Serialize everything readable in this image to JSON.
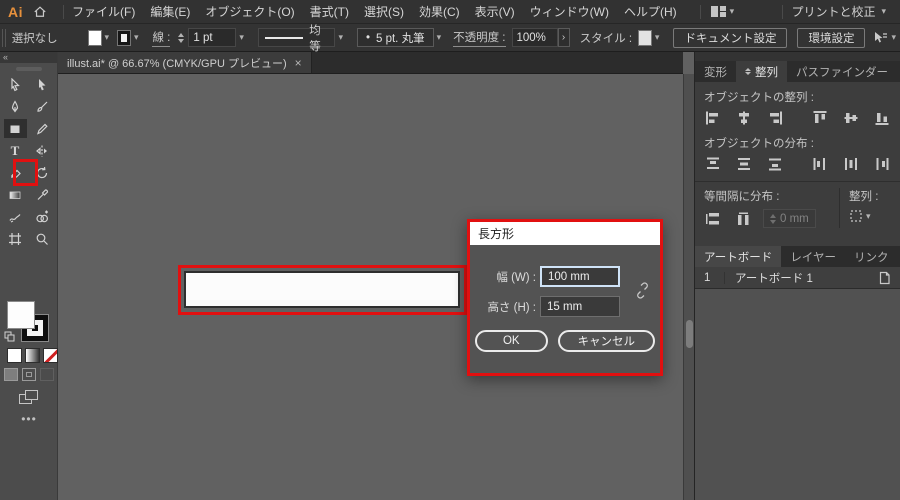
{
  "menu": {
    "logo": "Ai",
    "items": [
      "ファイル(F)",
      "編集(E)",
      "オブジェクト(O)",
      "書式(T)",
      "選択(S)",
      "効果(C)",
      "表示(V)",
      "ウィンドウ(W)",
      "ヘルプ(H)"
    ],
    "workspace": "プリントと校正"
  },
  "options": {
    "selection_status": "選択なし",
    "stroke_label": "線 :",
    "stroke_weight": "1 pt",
    "stroke_profile": "均等",
    "brush_bullet": "•",
    "brush_name": "5 pt. 丸筆",
    "opacity_label": "不透明度 :",
    "opacity_value": "100%",
    "opacity_more": "›",
    "style_label": "スタイル :",
    "document_setup": "ドキュメント設定",
    "preferences": "環境設定"
  },
  "doc_tab": {
    "title": "illust.ai* @ 66.67% (CMYK/GPU プレビュー)",
    "close": "×"
  },
  "dialog": {
    "title": "長方形",
    "width_label": "幅 (W) :",
    "width_value": "100 mm",
    "height_label": "高さ (H) :",
    "height_value": "15 mm",
    "ok": "OK",
    "cancel": "キャンセル"
  },
  "align_panel": {
    "tabs": [
      "変形",
      "整列",
      "パスファインダー"
    ],
    "menu_icon": "≡",
    "align_objects_label": "オブジェクトの整列 :",
    "distribute_objects_label": "オブジェクトの分布 :",
    "distribute_spacing_label": "等間隔に分布 :",
    "spacing_value": "0 mm",
    "align_to_label": "整列 :"
  },
  "artboard_panel": {
    "tabs": [
      "アートボード",
      "レイヤー",
      "リンク"
    ],
    "menu_icon": "≡",
    "rows": [
      {
        "number": "1",
        "name": "アートボード 1"
      }
    ]
  },
  "toolbar": {
    "collapse": "«",
    "ellipsis": "•••"
  },
  "colors": {
    "annotation_red": "#e11010",
    "active_field_border": "#cfe3f7",
    "canvas_gray": "#616161",
    "logo_orange": "#e8913c"
  }
}
